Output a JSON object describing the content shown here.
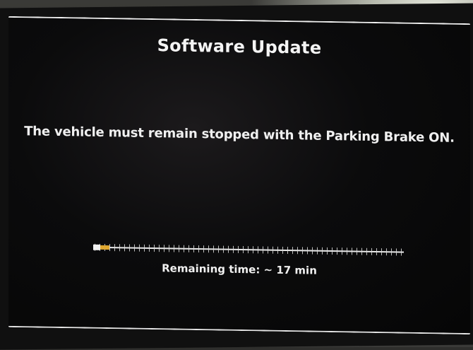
{
  "screen": {
    "title": "Software Update",
    "message": "The vehicle must remain stopped with the Parking Brake ON.",
    "remaining_time": "Remaining time: ~ 17 min"
  },
  "progress": {
    "value": 0.03,
    "fill_color": "#e0a830"
  }
}
